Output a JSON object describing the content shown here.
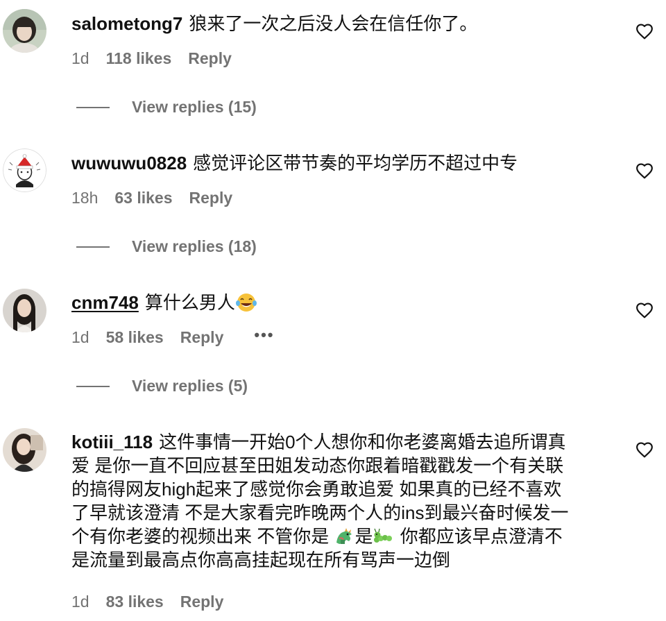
{
  "comments": [
    {
      "username": "salometong7",
      "text": "狼来了一次之后没人会在信任你了。",
      "time": "1d",
      "likes": "118 likes",
      "reply": "Reply",
      "view_replies": "View replies (15)"
    },
    {
      "username": "wuwuwu0828",
      "text": "感觉评论区带节奏的平均学历不超过中专",
      "time": "18h",
      "likes": "63 likes",
      "reply": "Reply",
      "view_replies": "View replies (18)"
    },
    {
      "username": "cnm748",
      "text": "算什么男人",
      "time": "1d",
      "likes": "58 likes",
      "reply": "Reply",
      "more": "•••",
      "view_replies": "View replies (5)"
    },
    {
      "username": "kotiii_118",
      "text_lines": [
        "这件事情一开始0个人想你和你老婆离婚去追所谓真",
        "爱 是你一直不回应甚至田姐发动态你跟着暗戳戳发一个有关联",
        "的搞得网友high起来了感觉你会勇敢追爱 如果真的已经不喜欢",
        "了早就该澄清 不是大家看完昨晚两个人的ins到最兴奋时候发一",
        "个有你老婆的视频出来 不管你是",
        "是",
        "你都应该早点澄清不",
        "是流量到最高点你高高挂起现在所有骂声一边倒"
      ],
      "time": "1d",
      "likes": "83 likes",
      "reply": "Reply"
    }
  ],
  "icons": {
    "heart": "heart-outline-icon",
    "laugh_emoji": "face-with-tears-of-joy-icon",
    "dragon_emoji": "dragon-icon",
    "caterpillar_emoji": "caterpillar-icon"
  },
  "colors": {
    "text": "#111111",
    "meta": "#737373"
  }
}
